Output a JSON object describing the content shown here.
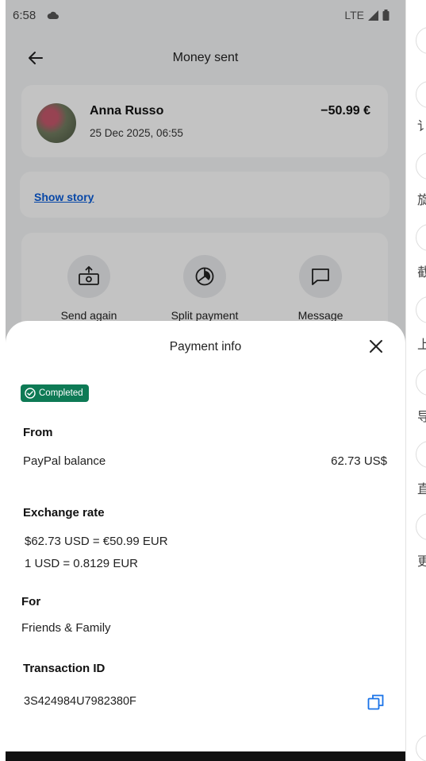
{
  "status_bar": {
    "time": "6:58",
    "network": "LTE"
  },
  "header": {
    "title": "Money sent"
  },
  "transaction": {
    "name": "Anna Russo",
    "datetime": "25 Dec 2025, 06:55",
    "amount": "−50.99 €"
  },
  "story_link": "Show story",
  "actions": [
    {
      "label": "Send again",
      "icon": "send-money-icon"
    },
    {
      "label": "Split payment",
      "icon": "pie-chart-icon"
    },
    {
      "label": "Message",
      "icon": "chat-bubble-icon"
    }
  ],
  "sheet": {
    "title": "Payment info",
    "status": "Completed",
    "from_label": "From",
    "from_source": "PayPal balance",
    "from_amount": "62.73 US$",
    "exchange_label": "Exchange rate",
    "exchange_line1": "$62.73 USD = €50.99 EUR",
    "exchange_line2": "1 USD = 0.8129 EUR",
    "for_label": "For",
    "for_value": "Friends & Family",
    "txn_label": "Transaction ID",
    "txn_value": "3S424984U7982380F"
  },
  "side_panel": {
    "glyphs": [
      "讠",
      "旋",
      "截",
      "上",
      "导",
      "直",
      "更"
    ]
  },
  "colors": {
    "accent_blue": "#0a5bd6",
    "badge_green": "#0e7a55",
    "link_blue": "#1a73e8"
  }
}
